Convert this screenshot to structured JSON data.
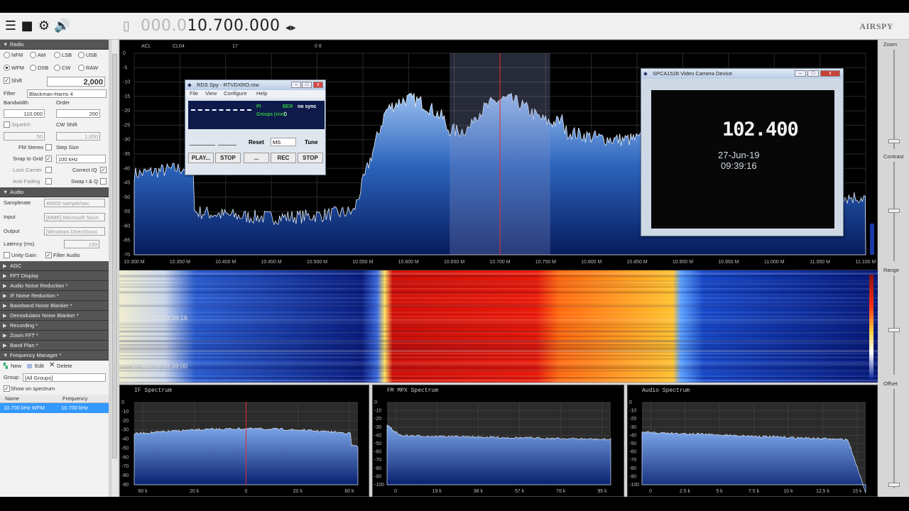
{
  "toolbar": {
    "freq_dim": "000.0",
    "freq_lit": "10.700.000",
    "logo": "AIRSPY"
  },
  "radio": {
    "title": "Radio",
    "modes_row1": [
      "NFM",
      "AM",
      "LSB",
      "USB"
    ],
    "modes_row2": [
      "WFM",
      "DSB",
      "CW",
      "RAW"
    ],
    "shift_label": "Shift",
    "shift_value": "2,000",
    "filter_label": "Filter",
    "filter_value": "Blackman-Harris 4",
    "bandwidth_label": "Bandwidth",
    "order_label": "Order",
    "bandwidth_value": "110,000",
    "order_value": "200",
    "squelch_label": "Squelch",
    "cw_shift_label": "CW Shift",
    "squelch_value": "50",
    "cw_shift_value": "1,000",
    "fm_stereo_label": "FM Stereo",
    "step_size_label": "Step Size",
    "snap_label": "Snap to Grid",
    "step_value": "100 kHz",
    "lock_carrier_label": "Lock Carrier",
    "correct_iq_label": "Correct IQ",
    "amp_fading_label": "Anti-Fading",
    "swap_iq_label": "Swap I & Q"
  },
  "audio": {
    "title": "Audio",
    "samplerate_label": "Samplerate",
    "samplerate_value": "48000 sample/sec",
    "input_label": "Input",
    "input_value": "[MME] Microsoft Soun",
    "output_label": "Output",
    "output_value": "[Windows DirectSoun",
    "latency_label": "Latency (ms)",
    "latency_value": "100",
    "unity_gain_label": "Unity Gain",
    "filter_audio_label": "Filter Audio"
  },
  "panels": [
    "AGC",
    "FFT Display",
    "Audio Noise Reduction *",
    "IF Noise Reduction *",
    "Baseband Noise Blanker *",
    "Demodulator Noise Blanker *",
    "Recording *",
    "Zoom FFT *",
    "Band Plan *"
  ],
  "freq_manager": {
    "title": "Frequency Manager *",
    "new_label": "New",
    "edit_label": "Edit",
    "delete_label": "Delete",
    "group_label": "Group:",
    "group_value": "[All Groups]",
    "show_label": "Show on spectrum",
    "col_name": "Name",
    "col_freq": "Frequency",
    "entry_name": "10.700 kHz WFM",
    "entry_freq": "10.700 kHz"
  },
  "spectrum": {
    "ticks_x": [
      "10.300 M",
      "10.350 M",
      "10.400 M",
      "10.450 M",
      "10.500 M",
      "10.550 M",
      "10.600 M",
      "10.650 M",
      "10.700 M",
      "10.750 M",
      "10.800 M",
      "10.850 M",
      "10.900 M",
      "10.950 M",
      "11.000 M",
      "11.050 M",
      "11.100 M"
    ],
    "ticks_y": [
      "0",
      "-5",
      "-10",
      "-15",
      "-20",
      "-25",
      "-30",
      "-35",
      "-40",
      "-45",
      "-50",
      "-55",
      "-60",
      "-65",
      "-70"
    ],
    "top_labels": [
      "ACL",
      "CL04",
      "17",
      "0 8"
    ],
    "waterfall_ts": [
      "27-Jun-19 09:39:16",
      "27-Jun-19 09:39:00"
    ]
  },
  "right_labels": {
    "zoom": "Zoom",
    "contrast": "Contrast",
    "range": "Range",
    "offset": "Offset"
  },
  "rds": {
    "title": "RDS Spy - RTVDXRO.rsw",
    "menu": [
      "File",
      "View",
      "Configure",
      "Help"
    ],
    "pi_label": "PI",
    "ber_label": "BER",
    "sync": "no sync",
    "groups_label": "Groups (rcvd)",
    "groups_value": "0",
    "reset_label": "Reset",
    "reset_sel": "MS",
    "tune_label": "Tune",
    "play": "PLAY...",
    "stop1": "STOP",
    "dots": "...",
    "rec": "REC",
    "stop2": "STOP"
  },
  "camera": {
    "title": "SPCA1528 Video Camera Device",
    "display": "102.400",
    "date": "27-Jun-19",
    "time": "09:39:16"
  },
  "if_spectrum": {
    "title": "IF Spectrum",
    "x": [
      "60 k",
      "20 k",
      "0",
      "20 k",
      "60 k"
    ],
    "y": [
      "0",
      "-10",
      "-20",
      "-30",
      "-40",
      "-50",
      "-60",
      "-70",
      "-80",
      "-90"
    ]
  },
  "fm_spectrum": {
    "title": "FM MPX Spectrum",
    "x": [
      "0",
      "19 k",
      "38 k",
      "57 k",
      "76 k",
      "95 k"
    ],
    "y": [
      "0",
      "-10",
      "-20",
      "-30",
      "-40",
      "-50",
      "-60",
      "-70",
      "-80",
      "-90",
      "-100"
    ]
  },
  "audio_spectrum": {
    "title": "Audio Spectrum",
    "x": [
      "0",
      "2.5 k",
      "5 k",
      "7.5 k",
      "10 k",
      "12.5 k",
      "15 k"
    ],
    "y": [
      "0",
      "-10",
      "-20",
      "-30",
      "-40",
      "-50",
      "-60",
      "-70",
      "-80",
      "-90",
      "-100"
    ]
  }
}
